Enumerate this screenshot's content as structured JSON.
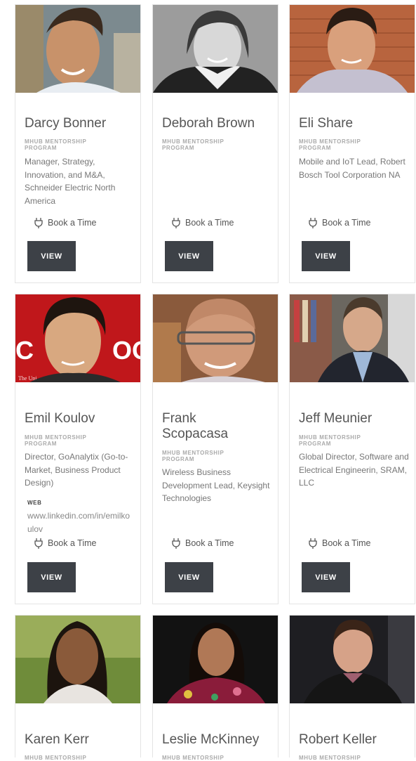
{
  "mentors": [
    {
      "name": "Darcy Bonner",
      "program": "MHUB MENTORSHIP PROGRAM",
      "role": "Manager, Strategy, Innovation, and M&A, Schneider Electric North America",
      "book_label": "Book a Time",
      "view_label": "VIEW"
    },
    {
      "name": "Deborah Brown",
      "program": "MHUB MENTORSHIP PROGRAM",
      "role": "",
      "book_label": "Book a Time",
      "view_label": "VIEW"
    },
    {
      "name": "Eli Share",
      "program": "MHUB MENTORSHIP PROGRAM",
      "role": "Mobile and IoT Lead, Robert Bosch Tool Corporation NA",
      "book_label": "Book a Time",
      "view_label": "VIEW"
    },
    {
      "name": "Emil Koulov",
      "program": "MHUB MENTORSHIP PROGRAM",
      "role": "Director, GoAnalytix (Go-to-Market, Business Product Design)",
      "web_label": "WEB",
      "web_url": "www.linkedin.com/in/emilkoulov",
      "book_label": "Book a Time",
      "view_label": "VIEW",
      "photo_text": "The Uni"
    },
    {
      "name": "Frank Scopacasa",
      "program": "MHUB MENTORSHIP PROGRAM",
      "role": "Wireless Business Development Lead, Keysight Technologies",
      "book_label": "Book a Time",
      "view_label": "VIEW"
    },
    {
      "name": "Jeff Meunier",
      "program": "MHUB MENTORSHIP PROGRAM",
      "role": "Global Director, Software and Electrical Engineerin, SRAM, LLC",
      "book_label": "Book a Time",
      "view_label": "VIEW"
    },
    {
      "name": "Karen Kerr",
      "program": "MHUB MENTORSHIP"
    },
    {
      "name": "Leslie McKinney",
      "program": "MHUB MENTORSHIP"
    },
    {
      "name": "Robert Keller",
      "program": "MHUB MENTORSHIP"
    }
  ],
  "colors": {
    "button_bg": "#3d4147",
    "card_border": "#e4e4e4",
    "program_text": "#aaaaaa"
  }
}
